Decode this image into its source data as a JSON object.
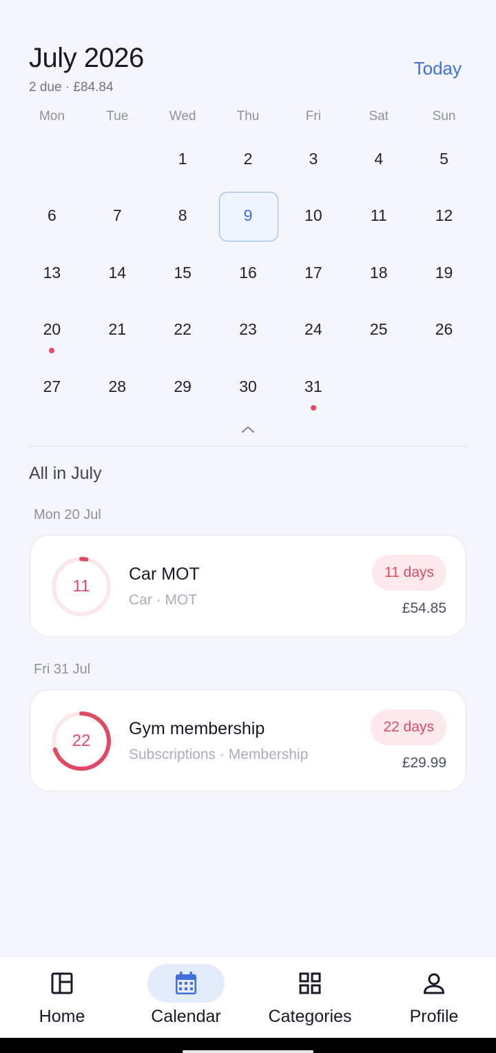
{
  "header": {
    "month_title": "July 2026",
    "summary": "2 due · £84.84",
    "today_label": "Today"
  },
  "weekdays": [
    "Mon",
    "Tue",
    "Wed",
    "Thu",
    "Fri",
    "Sat",
    "Sun"
  ],
  "calendar": {
    "leading_blank_days": 2,
    "days_in_month": 31,
    "selected_day": 9,
    "days_with_items": [
      20,
      31
    ]
  },
  "list": {
    "section_title": "All in July",
    "groups": [
      {
        "date_label": "Mon 20 Jul",
        "item": {
          "title": "Car MOT",
          "subtitle": "Car · MOT",
          "days_left": "11",
          "badge": "11 days",
          "amount": "£54.85",
          "ring_fraction": 0.03
        }
      },
      {
        "date_label": "Fri 31 Jul",
        "item": {
          "title": "Gym membership",
          "subtitle": "Subscriptions · Membership",
          "days_left": "22",
          "badge": "22 days",
          "amount": "£29.99",
          "ring_fraction": 0.7
        }
      }
    ]
  },
  "nav": {
    "items": [
      {
        "label": "Home",
        "icon": "home-icon"
      },
      {
        "label": "Calendar",
        "icon": "calendar-icon",
        "active": true
      },
      {
        "label": "Categories",
        "icon": "categories-icon"
      },
      {
        "label": "Profile",
        "icon": "profile-icon"
      }
    ]
  },
  "colors": {
    "accent": "#3f6fe0",
    "due": "#e04b63",
    "due_bg": "#fde8ec",
    "background": "#f4f6fb"
  }
}
